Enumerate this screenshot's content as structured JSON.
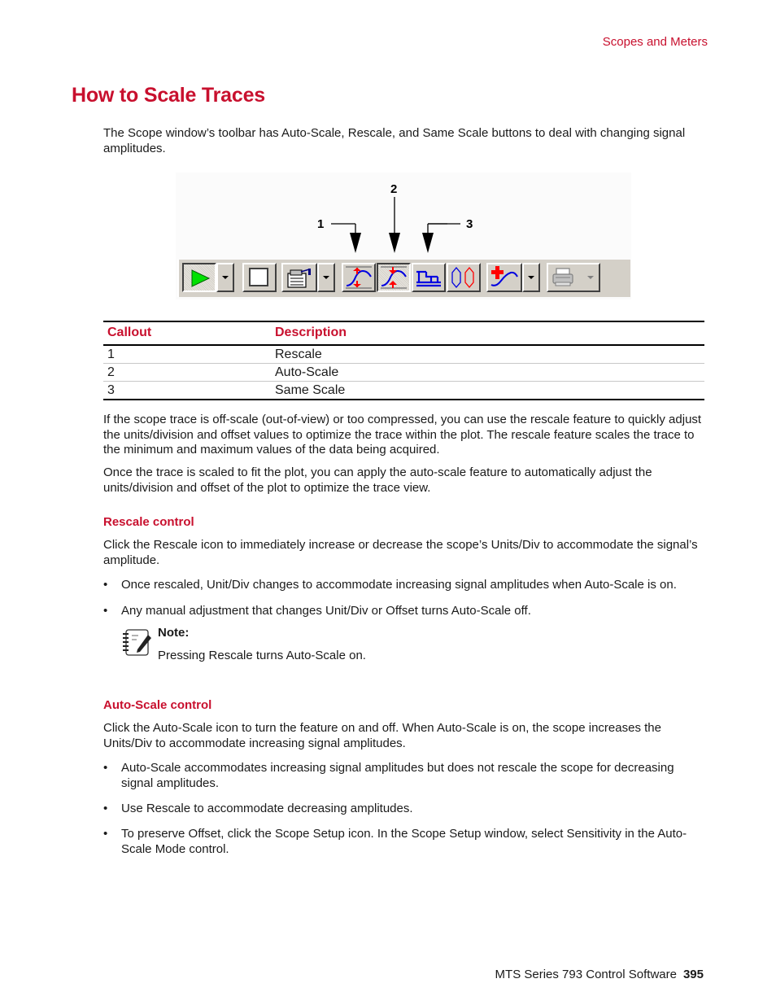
{
  "header": {
    "running_head": "Scopes and Meters"
  },
  "page": {
    "title": "How to Scale Traces",
    "intro": "The Scope window’s toolbar has Auto-Scale, Rescale, and Same Scale buttons to deal with changing signal amplitudes."
  },
  "figure": {
    "callouts": [
      "1",
      "2",
      "3"
    ],
    "toolbar": {
      "buttons": [
        {
          "name": "run",
          "icon": "play-icon",
          "state": "pressed",
          "has_dropdown": true
        },
        {
          "name": "stop",
          "icon": "stop-square-icon",
          "state": "normal",
          "has_dropdown": false
        },
        {
          "name": "scope-setup",
          "icon": "setup-clipboard-icon",
          "state": "normal",
          "has_dropdown": true
        },
        {
          "name": "rescale",
          "icon": "rescale-icon",
          "state": "normal",
          "has_dropdown": false,
          "callout": "1"
        },
        {
          "name": "auto-scale",
          "icon": "auto-scale-icon",
          "state": "pressed",
          "has_dropdown": false,
          "callout": "2"
        },
        {
          "name": "same-scale",
          "icon": "same-scale-icon",
          "state": "normal",
          "has_dropdown": false,
          "callout": "3"
        },
        {
          "name": "loops",
          "icon": "double-loop-icon",
          "state": "normal",
          "has_dropdown": false
        },
        {
          "name": "add-trace",
          "icon": "add-trace-icon",
          "state": "normal",
          "has_dropdown": true
        },
        {
          "name": "print",
          "icon": "printer-icon",
          "state": "disabled",
          "has_dropdown": true
        }
      ]
    }
  },
  "table": {
    "headers": [
      "Callout",
      "Description"
    ],
    "rows": [
      [
        "1",
        "Rescale"
      ],
      [
        "2",
        "Auto-Scale"
      ],
      [
        "3",
        "Same Scale"
      ]
    ]
  },
  "body": {
    "para1": "If the scope trace is off-scale (out-of-view) or too compressed, you can use the rescale feature to quickly adjust the units/division and offset values to optimize the trace within the plot. The rescale feature scales the trace to the minimum and maximum values of the data being acquired.",
    "para2": "Once the trace is scaled to fit the plot, you can apply the auto-scale feature to automatically adjust the units/division and offset of the plot to optimize the trace view."
  },
  "rescale_section": {
    "heading": "Rescale control",
    "intro": "Click the Rescale icon to immediately increase or decrease the scope’s Units/Div to accommodate the signal’s amplitude.",
    "bullets": [
      "Once rescaled, Unit/Div changes to accommodate increasing signal amplitudes when Auto-Scale is on.",
      "Any manual adjustment that changes Unit/Div or Offset turns Auto-Scale off."
    ],
    "note": {
      "label": "Note:",
      "text": "Pressing Rescale turns Auto-Scale on."
    }
  },
  "autoscale_section": {
    "heading": "Auto-Scale control",
    "intro": "Click the Auto-Scale icon to turn the feature on and off. When Auto-Scale is on, the scope increases the Units/Div to accommodate increasing signal amplitudes.",
    "bullets": [
      "Auto-Scale accommodates increasing signal amplitudes but does not rescale the scope for decreasing signal amplitudes.",
      "Use Rescale to accommodate decreasing amplitudes.",
      "To preserve Offset, click the Scope Setup icon. In the Scope Setup window, select Sensitivity in the Auto-Scale Mode control."
    ]
  },
  "footer": {
    "product": "MTS Series 793 Control Software",
    "page_number": "395"
  },
  "bullet_char": "•",
  "colors": {
    "accent": "#c8102e",
    "toolbar_bg": "#d4d0c8"
  }
}
